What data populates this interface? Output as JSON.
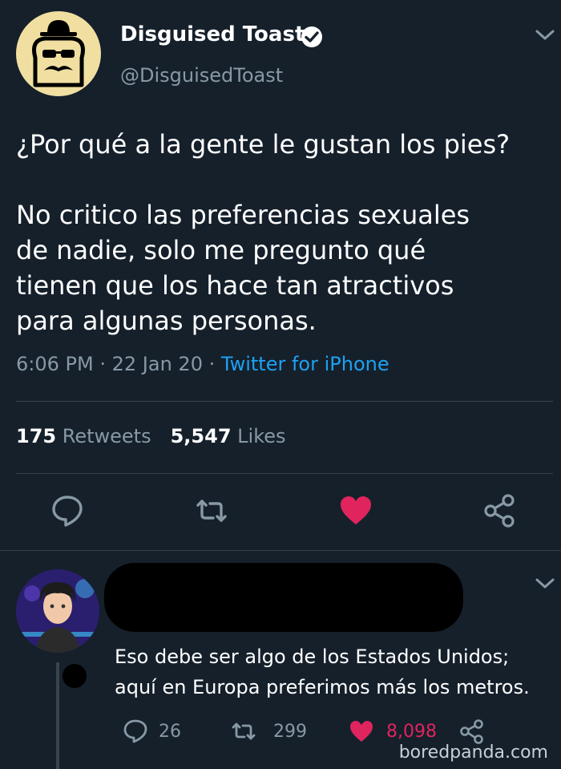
{
  "tweet": {
    "author_name": "Disguised Toast",
    "handle": "@DisguisedToast",
    "text": "¿Por qué a la gente le gustan los pies?\n\nNo critico las preferencias sexuales\nde nadie, solo me pregunto qué\ntienen que los hace tan atractivos\npara algunas personas.",
    "time": "6:06 PM",
    "date": "22 Jan 20",
    "separator": "·",
    "source": "Twitter for iPhone",
    "retweets_count": "175",
    "retweets_label": "Retweets",
    "likes_count": "5,547",
    "likes_label": "Likes"
  },
  "reply": {
    "text": "Eso debe ser algo de los Estados Unidos;\naquí en Europa preferimos más los metros.",
    "reply_count": "26",
    "retweet_count": "299",
    "like_count": "8,098"
  },
  "watermark": "boredpanda.com",
  "colors": {
    "background": "#15202b",
    "text": "#ffffff",
    "secondary": "#8899a6",
    "link": "#1da1f2",
    "like": "#e0245e",
    "divider": "#38444d",
    "avatar_bg": "#f0dfa1"
  },
  "icons": [
    "verified-badge-icon",
    "chevron-down-icon",
    "reply-icon",
    "retweet-icon",
    "heart-icon",
    "share-icon"
  ]
}
